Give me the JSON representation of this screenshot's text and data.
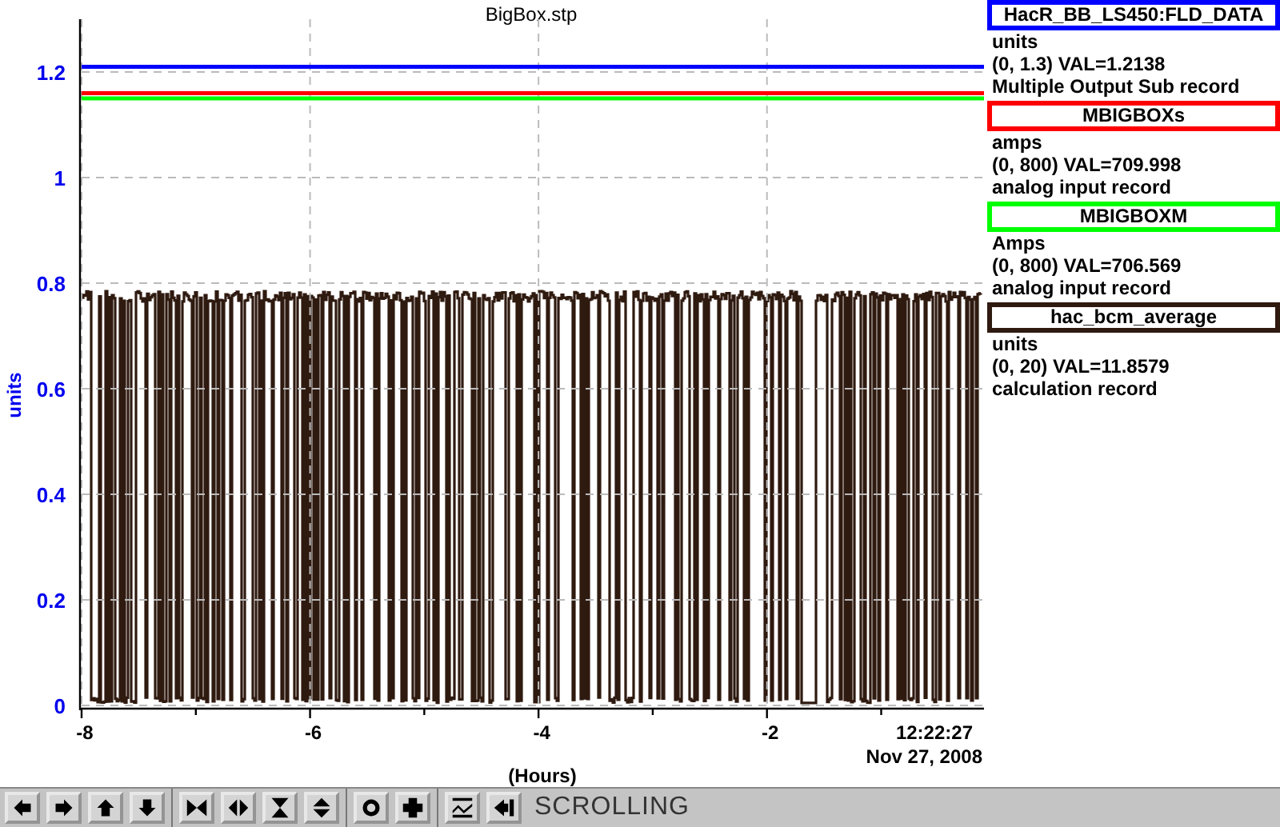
{
  "chart": {
    "timestamp_time": "12:22:27",
    "timestamp_date": "Nov 27, 2008",
    "chart_data": {
      "type": "line",
      "grid": true,
      "title": "BigBox.stp",
      "xlabel": "(Hours)",
      "ylabel": "units",
      "x": [
        -8,
        -0.1
      ],
      "xlim": [
        -8,
        -0.1
      ],
      "ylim": [
        0,
        1.3
      ],
      "xticks": [
        -8,
        -6,
        -4,
        -2
      ],
      "yticks": [
        {
          "value": 0,
          "label": "0"
        },
        {
          "value": 0.2,
          "label": "0.2"
        },
        {
          "value": 0.4,
          "label": "0.4"
        },
        {
          "value": 0.6,
          "label": "0.6"
        },
        {
          "value": 0.8,
          "label": "0.8"
        },
        {
          "value": 1,
          "label": "1"
        },
        {
          "value": 1.2,
          "label": "1.2"
        }
      ],
      "series": [
        {
          "name": "HacR_BB_LS450:FLD_DATA",
          "color": "#0000ff",
          "values": [
            1.21,
            1.21
          ]
        },
        {
          "name": "MBIGBOXs",
          "color": "#ff0000",
          "values": [
            1.16,
            1.16
          ]
        },
        {
          "name": "MBIGBOXM",
          "color": "#00ff00",
          "values": [
            1.15,
            1.15
          ]
        }
      ]
    }
  },
  "legend": [
    {
      "units": "units",
      "range": "(0, 1.3) VAL=1.2138",
      "record": "Multiple Output Sub record"
    },
    {
      "units": "amps",
      "range": "(0, 800) VAL=709.998",
      "record": "analog input record"
    },
    {
      "units": "Amps",
      "range": "(0, 800) VAL=706.569",
      "record": "analog input record"
    },
    {
      "name": "hac_bcm_average",
      "color": "#2f1a10",
      "units": "units",
      "range": "(0, 20) VAL=11.8579",
      "record": "calculation record"
    }
  ],
  "toolbar": {
    "mode": "SCROLLING"
  }
}
